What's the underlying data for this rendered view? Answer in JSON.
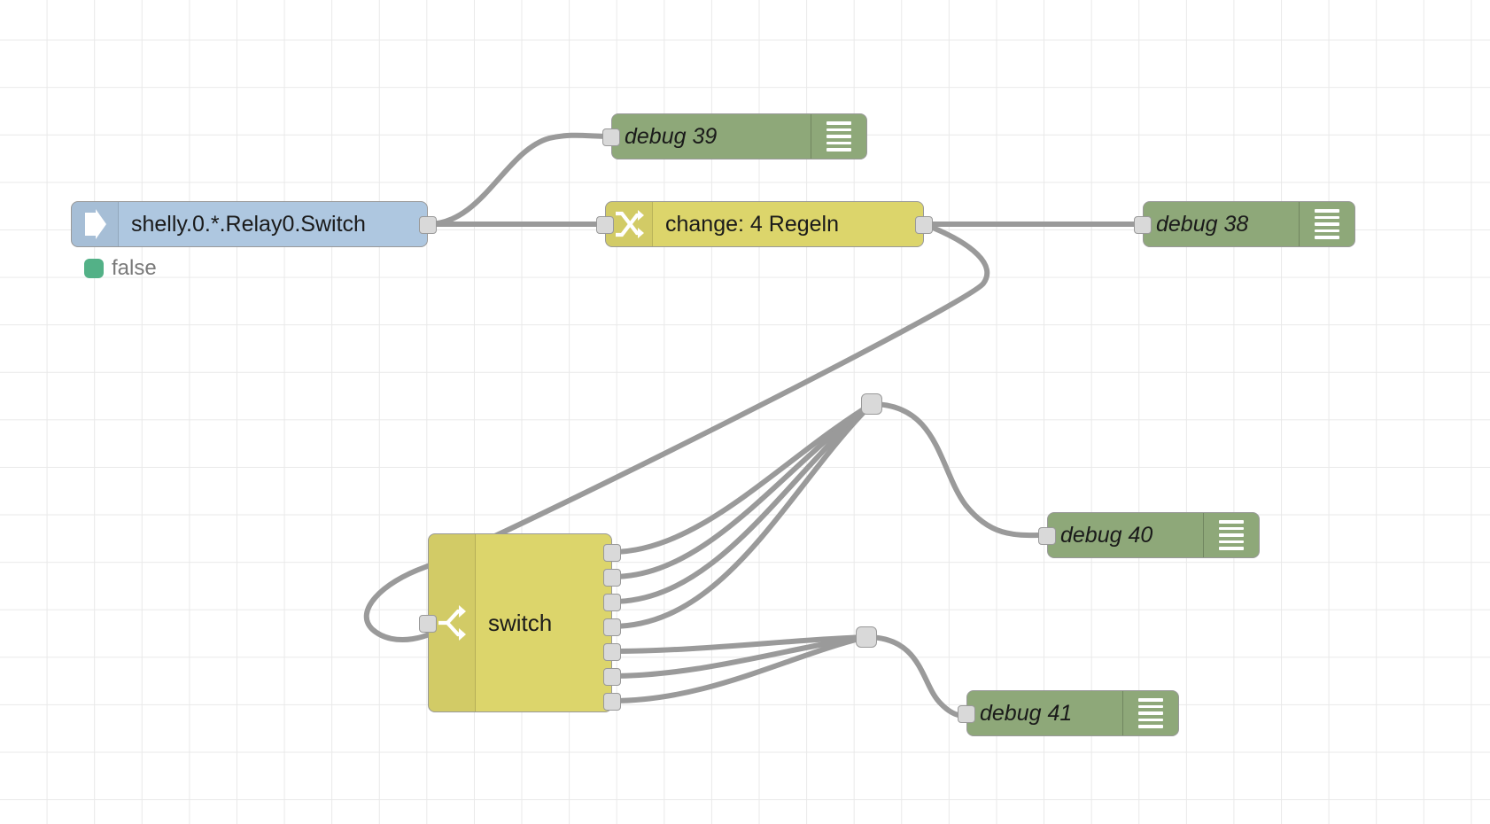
{
  "editor": {
    "type": "node-red-flow-canvas",
    "grid_color": "#e9e9e9",
    "wire_color": "#9a9a9a"
  },
  "palette": {
    "blue": "#aec7e0",
    "green": "#8ea879",
    "yellow": "#dcd56b",
    "status_green": "#53b187",
    "port_fill": "#d9d9d9",
    "port_stroke": "#999999"
  },
  "nodes": {
    "shelly_in": {
      "label": "shelly.0.*.Relay0.Switch",
      "icon": "arrow-right-icon",
      "color": "blue",
      "status": "false",
      "status_color": "#53b187"
    },
    "debug39": {
      "label": "debug 39",
      "icon": "debug-lines-icon",
      "color": "green",
      "button_state": "on"
    },
    "change": {
      "label": "change: 4 Regeln",
      "icon": "change-shuffle-icon",
      "color": "yellow"
    },
    "debug38": {
      "label": "debug 38",
      "icon": "debug-lines-icon",
      "color": "green",
      "button_state": "off"
    },
    "switch": {
      "label": "switch",
      "icon": "switch-branch-icon",
      "color": "yellow",
      "output_count": 7
    },
    "debug40": {
      "label": "debug 40",
      "icon": "debug-lines-icon",
      "color": "green",
      "button_state": "off"
    },
    "debug41": {
      "label": "debug 41",
      "icon": "debug-lines-icon",
      "color": "green",
      "button_state": "off"
    }
  },
  "junctions": [
    {
      "name": "junction-top"
    },
    {
      "name": "junction-bottom"
    }
  ]
}
